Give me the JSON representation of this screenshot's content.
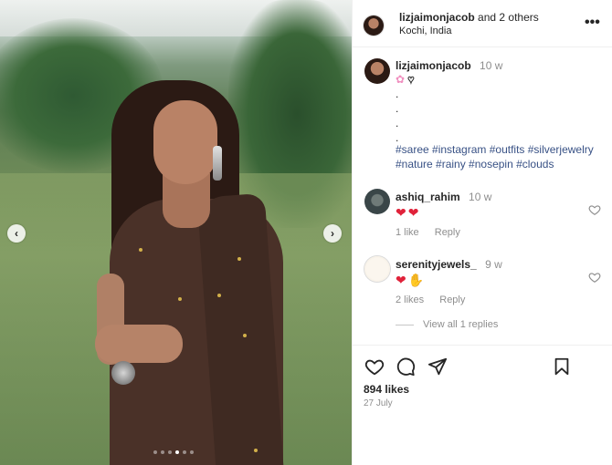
{
  "post": {
    "author": "lizjaimonjacob",
    "coauthors_suffix": "and 2 others",
    "location": "Kochi, India",
    "caption": {
      "username": "lizjaimonjacob",
      "time": "10 w",
      "dots": [
        ".",
        ".",
        ".",
        "."
      ],
      "hashtags": "#saree #instagram #outfits #silverjewelry #nature #rainy #nosepin #clouds"
    },
    "comments": [
      {
        "username": "ashiq_rahim",
        "time": "10 w",
        "likes_text": "1 like",
        "reply_label": "Reply",
        "emoji_count": 2
      },
      {
        "username": "serenityjewels_",
        "time": "9 w",
        "likes_text": "2 likes",
        "reply_label": "Reply",
        "emoji_count": 2
      }
    ],
    "view_replies": "View all 1 replies",
    "likes": "894 likes",
    "date": "27 July",
    "carousel": {
      "count": 6,
      "active_index": 3
    }
  },
  "icons": {
    "more": "more-options-icon",
    "like": "heart-icon",
    "comment": "comment-icon",
    "share": "share-icon",
    "save": "bookmark-icon",
    "prev": "chevron-left-icon",
    "next": "chevron-right-icon"
  },
  "colors": {
    "hashtag": "#385185",
    "heart_red": "#e0223a",
    "muted": "#8e8e8e"
  }
}
